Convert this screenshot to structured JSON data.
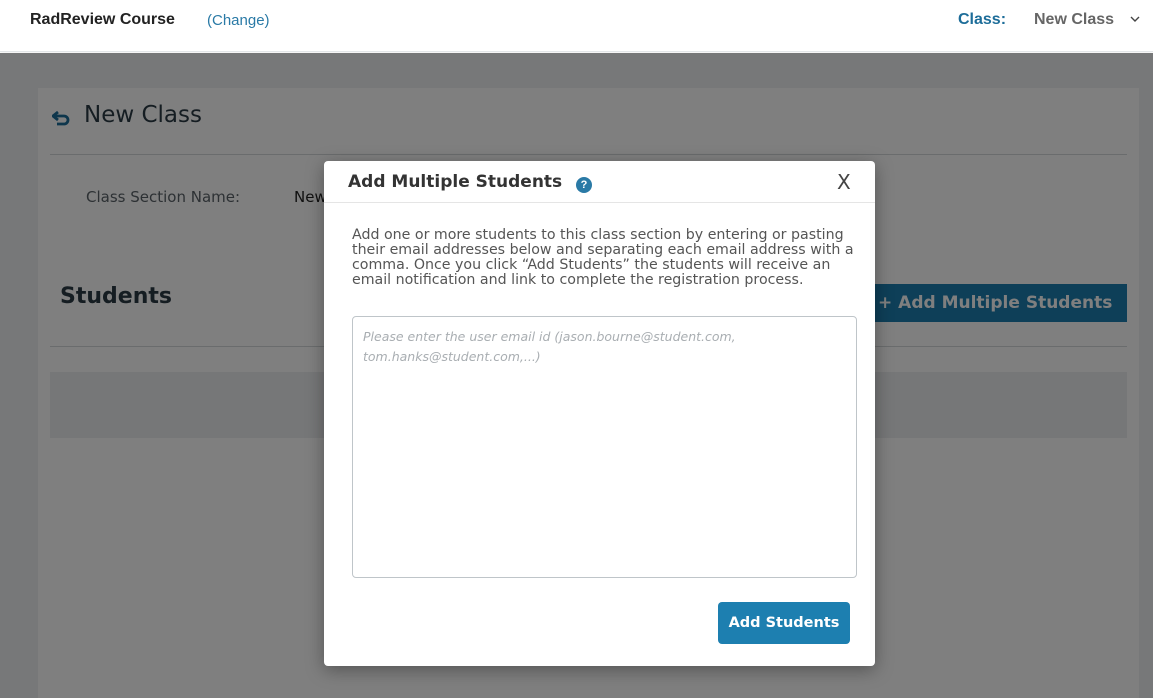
{
  "topbar": {
    "course_name": "RadReview Course",
    "course_change": "(Change)",
    "class_label": "Class:",
    "class_value": "New Class"
  },
  "panel": {
    "title": "New Class",
    "section_label": "Class Section Name:",
    "section_value": "New Class",
    "students_heading": "Students",
    "add_multiple_button": "+ Add Multiple Students"
  },
  "modal": {
    "title": "Add Multiple Students",
    "help_icon_glyph": "?",
    "close_label": "X",
    "description": "Add one or more students to this class section by entering or pasting their email addresses below and separating each email address with a comma. Once you click “Add Students” the students will receive an email notification and link to complete the registration process.",
    "email_placeholder": "Please enter the user email id (jason.bourne@student.com, tom.hanks@student.com,...)",
    "submit_label": "Add Students"
  },
  "colors": {
    "accent": "#1d7fb0",
    "link": "#2a7aa6",
    "overlay": "rgba(0,0,0,0.5)"
  },
  "icons": {
    "back": "undo-arrow-icon",
    "help": "question-circle-icon",
    "class_dropdown": "chevron-down-icon"
  }
}
